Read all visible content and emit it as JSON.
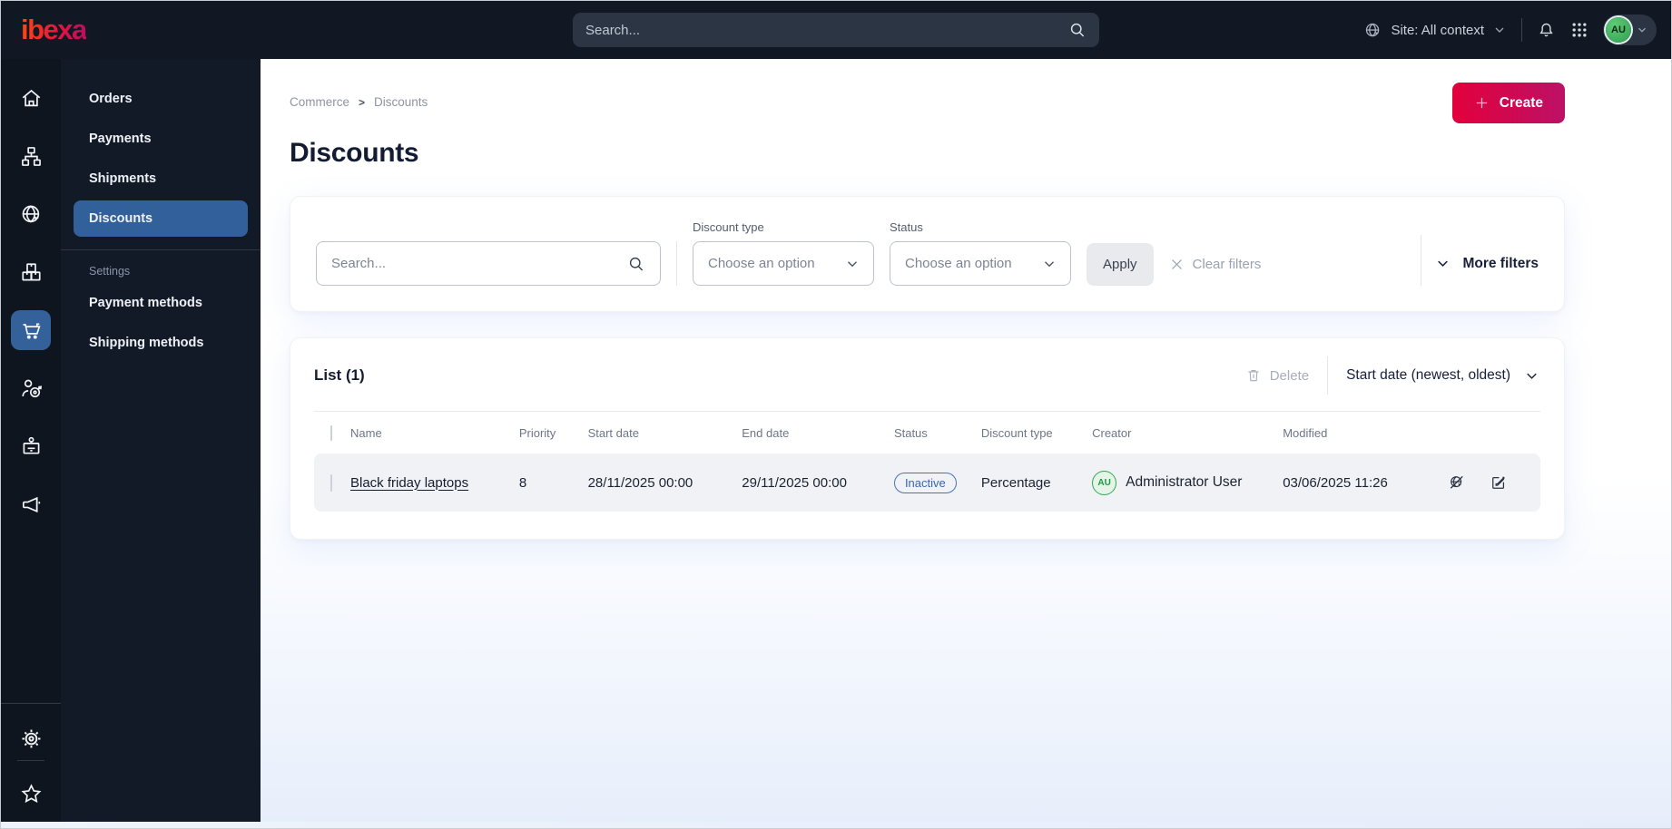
{
  "topbar": {
    "logo": "ibexa",
    "search_placeholder": "Search...",
    "site_label": "Site: All context",
    "avatar_initials": "AU"
  },
  "menu": {
    "items": [
      "Orders",
      "Payments",
      "Shipments",
      "Discounts"
    ],
    "active_item": "Discounts",
    "settings_label": "Settings",
    "settings_items": [
      "Payment methods",
      "Shipping methods"
    ]
  },
  "breadcrumb": {
    "items": [
      "Commerce",
      "Discounts"
    ],
    "separator": ">"
  },
  "page": {
    "title": "Discounts",
    "create_label": "Create"
  },
  "filters": {
    "search_placeholder": "Search...",
    "discount_type_label": "Discount type",
    "discount_type_value": "Choose an option",
    "status_label": "Status",
    "status_value": "Choose an option",
    "apply_label": "Apply",
    "clear_label": "Clear filters",
    "more_label": "More filters"
  },
  "list": {
    "title": "List (1)",
    "delete_label": "Delete",
    "sort_label": "Start date (newest, oldest)",
    "columns": [
      "Name",
      "Priority",
      "Start date",
      "End date",
      "Status",
      "Discount type",
      "Creator",
      "Modified"
    ],
    "rows": [
      {
        "name": "Black friday laptops",
        "priority": "8",
        "start_date": "28/11/2025 00:00",
        "end_date": "29/11/2025 00:00",
        "status": "Inactive",
        "discount_type": "Percentage",
        "creator_initials": "AU",
        "creator": "Administrator User",
        "modified": "03/06/2025 11:26"
      }
    ]
  },
  "colors": {
    "topbar_bg": "#111823",
    "rail_bg": "#0e151e",
    "menu_bg": "#131a27",
    "active_blue": "#32609a",
    "accent_gradient_start": "#e3003c",
    "accent_gradient_end": "#bc1166",
    "badge_blue": "#4a73b5",
    "avatar_green": "#2fa84f"
  },
  "icons": [
    "home",
    "sitemap",
    "globe-cursor",
    "products",
    "cart",
    "customer-target",
    "badge",
    "megaphone",
    "gear",
    "star",
    "search",
    "bell",
    "app-grid",
    "chevron-down",
    "plus",
    "trash",
    "clear-x",
    "preview-disabled",
    "edit",
    "checkbox"
  ]
}
